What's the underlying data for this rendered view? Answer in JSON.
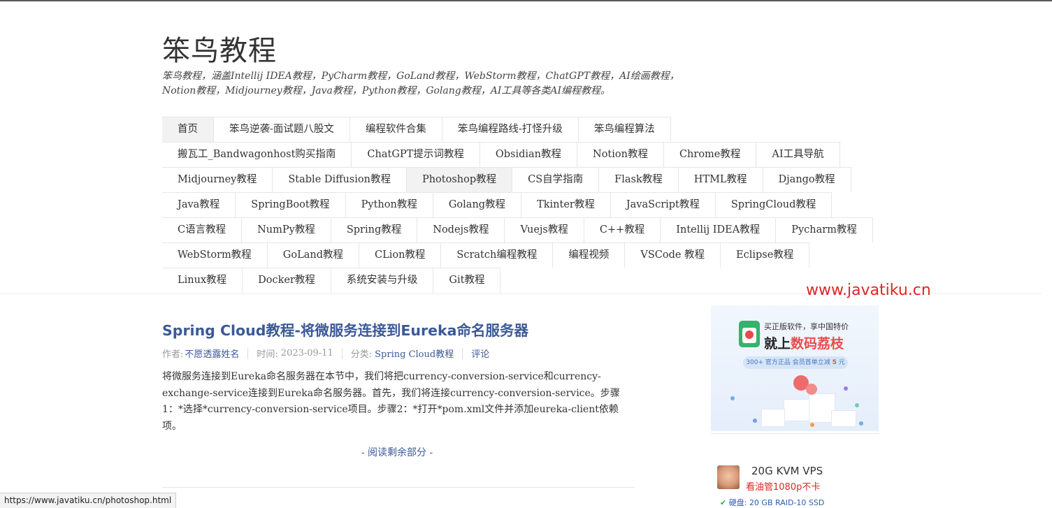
{
  "site": {
    "title": "笨鸟教程",
    "description": "笨鸟教程，涵盖Intellij IDEA教程，PyCharm教程，GoLand教程，WebStorm教程，ChatGPT教程，AI绘画教程，Notion教程，Midjourney教程，Java教程，Python教程，Golang教程，AI工具等各类AI编程教程。"
  },
  "nav": {
    "items": [
      "首页",
      "笨鸟逆袭-面试题八股文",
      "编程软件合集",
      "笨鸟编程路线-打怪升级",
      "笨鸟编程算法",
      "搬瓦工_Bandwagonhost购买指南",
      "ChatGPT提示词教程",
      "Obsidian教程",
      "Notion教程",
      "Chrome教程",
      "AI工具导航",
      "Midjourney教程",
      "Stable Diffusion教程",
      "Photoshop教程",
      "CS自学指南",
      "Flask教程",
      "HTML教程",
      "Django教程",
      "Java教程",
      "SpringBoot教程",
      "Python教程",
      "Golang教程",
      "Tkinter教程",
      "JavaScript教程",
      "SpringCloud教程",
      "C语言教程",
      "NumPy教程",
      "Spring教程",
      "Nodejs教程",
      "Vuejs教程",
      "C++教程",
      "Intellij IDEA教程",
      "Pycharm教程",
      "WebStorm教程",
      "GoLand教程",
      "CLion教程",
      "Scratch编程教程",
      "编程视频",
      "VSCode 教程",
      "Eclipse教程",
      "Linux教程",
      "Docker教程",
      "系统安装与升级",
      "Git教程"
    ],
    "active_items": [
      "首页",
      "Photoshop教程"
    ],
    "row_breaks_after": [
      4,
      10,
      17,
      24,
      32,
      39
    ]
  },
  "watermark": "www.javatiku.cn",
  "post": {
    "title": "Spring Cloud教程-将微服务连接到Eureka命名服务器",
    "author_label": "作者:",
    "author": "不愿透露姓名",
    "time_label": "时间:",
    "time": "2023-09-11",
    "category_label": "分类:",
    "category": "Spring Cloud教程",
    "comments": "评论",
    "excerpt": "将微服务连接到Eureka命名服务器在本节中，我们将把currency-conversion-service和currency-exchange-service连接到Eureka命名服务器。首先，我们将连接currency-conversion-service。步骤1：*选择*currency-conversion-service项目。步骤2：*打开*pom.xml文件并添加eureka-client依赖项。",
    "read_more": "- 阅读剩余部分 -"
  },
  "ads": {
    "ad1": {
      "line1": "买正版软件，享中国特价",
      "line2_prefix": "就上",
      "line2_highlight": "数码荔枝",
      "pill_prefix": "300+ 官方正品  会员首单立减 ",
      "pill_number": "5",
      "pill_suffix": " 元"
    },
    "ad2": {
      "line1": "20G KVM VPS",
      "line2": "看油管1080p不卡",
      "line3_label": "硬盘:",
      "line3_value": "20 GB RAID-10 SSD"
    }
  },
  "statusbar": {
    "url": "https://www.javatiku.cn/photoshop.html"
  },
  "colors": {
    "link": "#3b5998",
    "watermark": "#e12424",
    "nav_active_bg": "#f2f2f2"
  }
}
